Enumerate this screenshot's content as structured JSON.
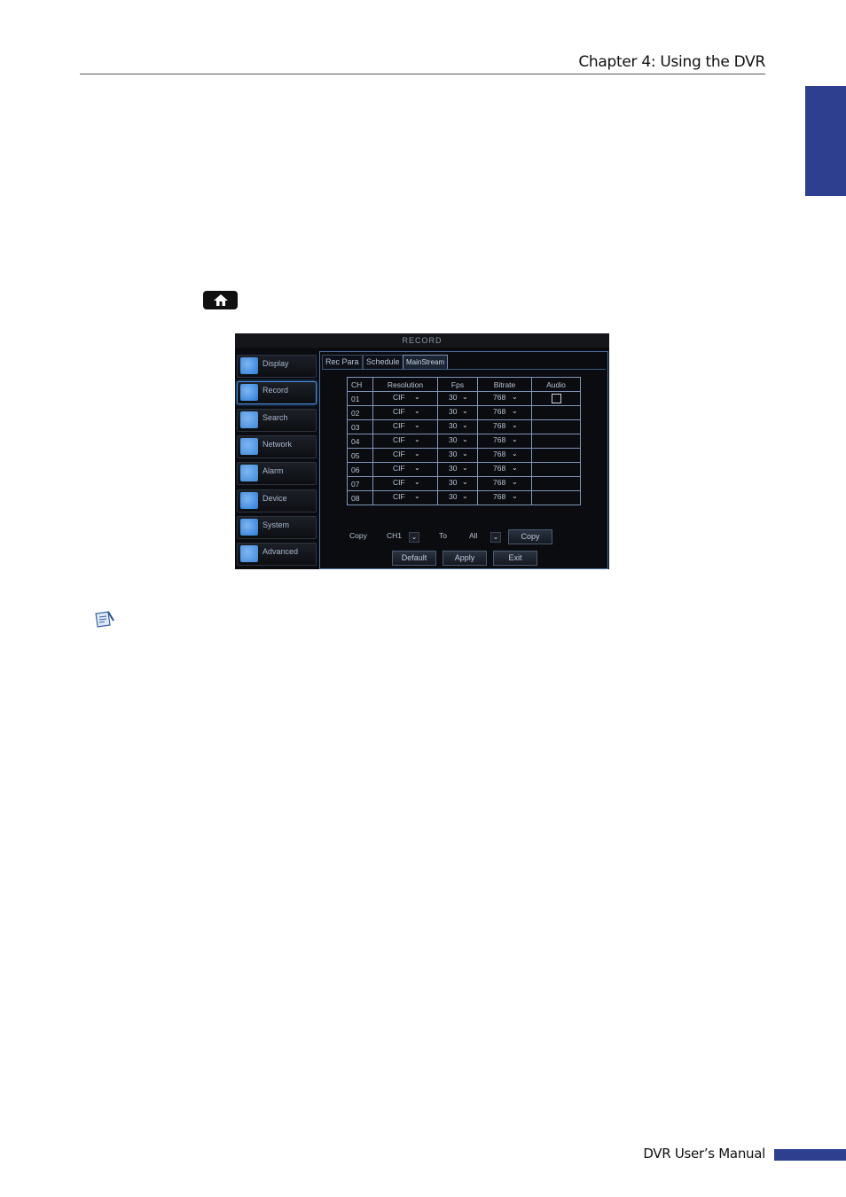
{
  "header": {
    "chapter_title": "Chapter 4: Using the DVR"
  },
  "footer": {
    "manual_title": "DVR User’s Manual"
  },
  "dvr": {
    "window_title": "RECORD",
    "menu": [
      {
        "label": "Display",
        "icon": "monitor-icon"
      },
      {
        "label": "Record",
        "icon": "record-icon"
      },
      {
        "label": "Search",
        "icon": "search-icon"
      },
      {
        "label": "Network",
        "icon": "network-icon"
      },
      {
        "label": "Alarm",
        "icon": "alarm-icon"
      },
      {
        "label": "Device",
        "icon": "device-icon"
      },
      {
        "label": "System",
        "icon": "gear-icon"
      },
      {
        "label": "Advanced",
        "icon": "wrench-icon"
      }
    ],
    "active_menu": "Record",
    "tabs": [
      "Rec Para",
      "Schedule",
      "MainStream"
    ],
    "active_tab": "MainStream",
    "columns": [
      "CH",
      "Resolution",
      "Fps",
      "Bitrate",
      "Audio"
    ],
    "rows": [
      {
        "ch": "01",
        "resolution": "CIF",
        "fps": "30",
        "bitrate": "768",
        "audio_checkbox": true
      },
      {
        "ch": "02",
        "resolution": "CIF",
        "fps": "30",
        "bitrate": "768",
        "audio_checkbox": false
      },
      {
        "ch": "03",
        "resolution": "CIF",
        "fps": "30",
        "bitrate": "768",
        "audio_checkbox": false
      },
      {
        "ch": "04",
        "resolution": "CIF",
        "fps": "30",
        "bitrate": "768",
        "audio_checkbox": false
      },
      {
        "ch": "05",
        "resolution": "CIF",
        "fps": "30",
        "bitrate": "768",
        "audio_checkbox": false
      },
      {
        "ch": "06",
        "resolution": "CIF",
        "fps": "30",
        "bitrate": "768",
        "audio_checkbox": false
      },
      {
        "ch": "07",
        "resolution": "CIF",
        "fps": "30",
        "bitrate": "768",
        "audio_checkbox": false
      },
      {
        "ch": "08",
        "resolution": "CIF",
        "fps": "30",
        "bitrate": "768",
        "audio_checkbox": false
      }
    ],
    "copy_row": {
      "copy_label": "Copy",
      "from_value": "CH1",
      "to_label": "To",
      "to_value": "All",
      "copy_button": "Copy"
    },
    "buttons": {
      "default": "Default",
      "apply": "Apply",
      "exit": "Exit"
    }
  },
  "colors": {
    "accent": "#2e3f8f",
    "dvr_border": "#4f6e99"
  }
}
